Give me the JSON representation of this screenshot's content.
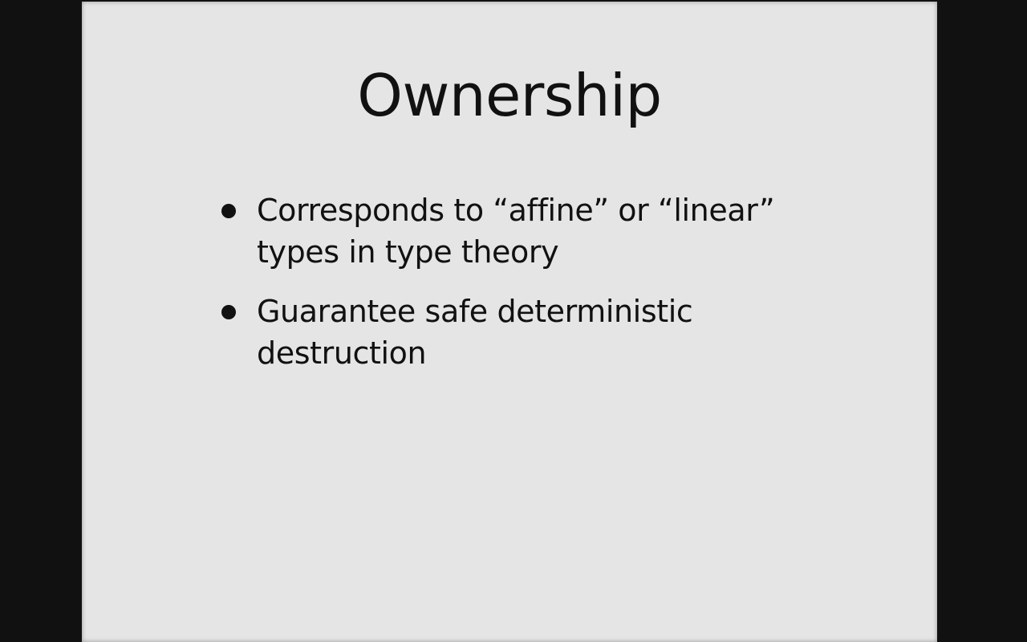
{
  "slide": {
    "title": "Ownership",
    "bullets": [
      {
        "text": "Corresponds to “affine” or “linear” types in type theory"
      },
      {
        "text": "Guarantee safe deterministic destruction"
      }
    ]
  },
  "colors": {
    "background": "#111111",
    "slide": "#e5e5e5",
    "text": "#111111"
  }
}
